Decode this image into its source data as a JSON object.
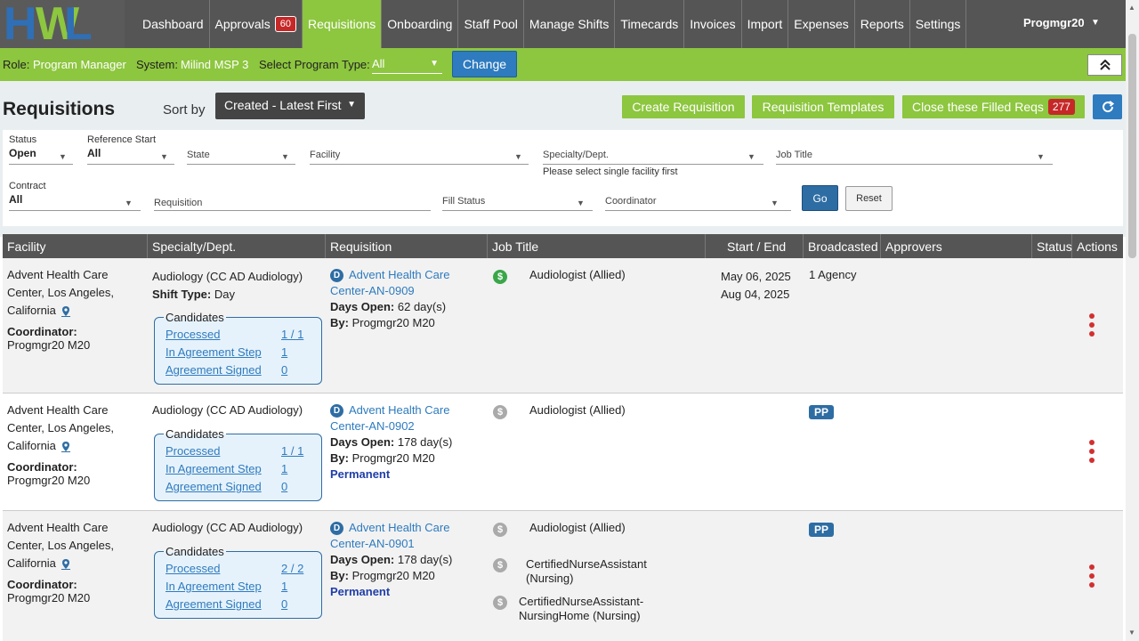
{
  "logo": {
    "letters": [
      "H",
      "W",
      "L"
    ]
  },
  "nav": {
    "items": [
      "Dashboard",
      "Approvals",
      "Requisitions",
      "Onboarding",
      "Staff Pool",
      "Manage Shifts",
      "Timecards",
      "Invoices",
      "Import",
      "Expenses",
      "Reports",
      "Settings"
    ],
    "approvals_badge": "60",
    "active": "Requisitions",
    "user": "Progmgr20"
  },
  "context": {
    "role_label": "Role:",
    "role": "Program Manager",
    "system_label": "System:",
    "system": "Milind MSP 3",
    "program_type_label": "Select Program Type:",
    "program_type": "All",
    "change_label": "Change"
  },
  "page": {
    "title": "Requisitions",
    "sort_label": "Sort by",
    "sort_value": "Created - Latest First",
    "create_label": "Create Requisition",
    "templates_label": "Requisition Templates",
    "close_filled_label": "Close these Filled Reqs",
    "close_filled_count": "277"
  },
  "filters": {
    "status": {
      "label": "Status",
      "value": "Open"
    },
    "reference_start": {
      "label": "Reference Start",
      "value": "All"
    },
    "state": {
      "placeholder": "State"
    },
    "facility": {
      "placeholder": "Facility"
    },
    "specialty": {
      "placeholder": "Specialty/Dept.",
      "hint": "Please select single facility first"
    },
    "job_title": {
      "placeholder": "Job Title"
    },
    "contract": {
      "label": "Contract",
      "value": "All"
    },
    "requisition": {
      "placeholder": "Requisition"
    },
    "fill_status": {
      "placeholder": "Fill Status"
    },
    "coordinator": {
      "placeholder": "Coordinator"
    },
    "go_label": "Go",
    "reset_label": "Reset"
  },
  "table": {
    "columns": [
      "Facility",
      "Specialty/Dept.",
      "Requisition",
      "Job Title",
      "Start / End",
      "Broadcasted",
      "Approvers",
      "Status",
      "Actions"
    ],
    "candidates_label": "Candidates",
    "processed_label": "Processed",
    "agreement_step_label": "In Agreement Step",
    "agreement_signed_label": "Agreement Signed",
    "coordinator_label": "Coordinator:",
    "days_open_label": "Days Open:",
    "by_label": "By:",
    "shift_type_label": "Shift Type:",
    "rows": [
      {
        "facility": [
          "Advent Health Care",
          "Center, Los Angeles,",
          "California"
        ],
        "coordinator": "Progmgr20 M20",
        "specialty": "Audiology (CC AD Audiology)",
        "shift_type": "Day",
        "processed": "1 / 1",
        "agreement_step": "1",
        "agreement_signed": "0",
        "req_badge": "D",
        "req_name": [
          "Advent Health Care",
          "Center-AN-0909"
        ],
        "days_open": "62 day(s)",
        "by": "Progmgr20 M20",
        "permanent": "",
        "jobs": [
          {
            "title": "Audiologist (Allied)",
            "pay": "green"
          }
        ],
        "start": "May 06, 2025",
        "end": "Aug 04, 2025",
        "broadcasted": "1 Agency"
      },
      {
        "facility": [
          "Advent Health Care",
          "Center, Los Angeles,",
          "California"
        ],
        "coordinator": "Progmgr20 M20",
        "specialty": "Audiology (CC AD Audiology)",
        "shift_type": "",
        "processed": "1 / 1",
        "agreement_step": "1",
        "agreement_signed": "0",
        "req_badge": "D",
        "req_name": [
          "Advent Health Care",
          "Center-AN-0902"
        ],
        "days_open": "178 day(s)",
        "by": "Progmgr20 M20",
        "permanent": "Permanent",
        "jobs": [
          {
            "title": "Audiologist (Allied)",
            "pay": "grey"
          }
        ],
        "start": "",
        "end": "",
        "broadcasted": "PP"
      },
      {
        "facility": [
          "Advent Health Care",
          "Center, Los Angeles,",
          "California"
        ],
        "coordinator": "Progmgr20 M20",
        "specialty": "Audiology (CC AD Audiology)",
        "shift_type": "",
        "processed": "2 / 2",
        "agreement_step": "1",
        "agreement_signed": "0",
        "req_badge": "D",
        "req_name": [
          "Advent Health Care",
          "Center-AN-0901"
        ],
        "days_open": "178 day(s)",
        "by": "Progmgr20 M20",
        "permanent": "Permanent",
        "jobs": [
          {
            "title": "Audiologist (Allied)",
            "pay": "grey"
          },
          {
            "title": "CertifiedNurseAssistant (Nursing)",
            "title_lines": [
              "CertifiedNurseAssistant",
              "(Nursing)"
            ],
            "pay": "grey"
          },
          {
            "title": "CertifiedNurseAssistant-NursingHome (Nursing)",
            "title_lines": [
              "CertifiedNurseAssistant-",
              "NursingHome (Nursing)"
            ],
            "pay": "grey"
          }
        ],
        "start": "",
        "end": "",
        "broadcasted": "PP"
      }
    ]
  },
  "colors": {
    "nav_bg": "#555555",
    "accent_green": "#8dc63f",
    "primary_blue": "#2e7bbf",
    "danger_red": "#d32f2f"
  }
}
